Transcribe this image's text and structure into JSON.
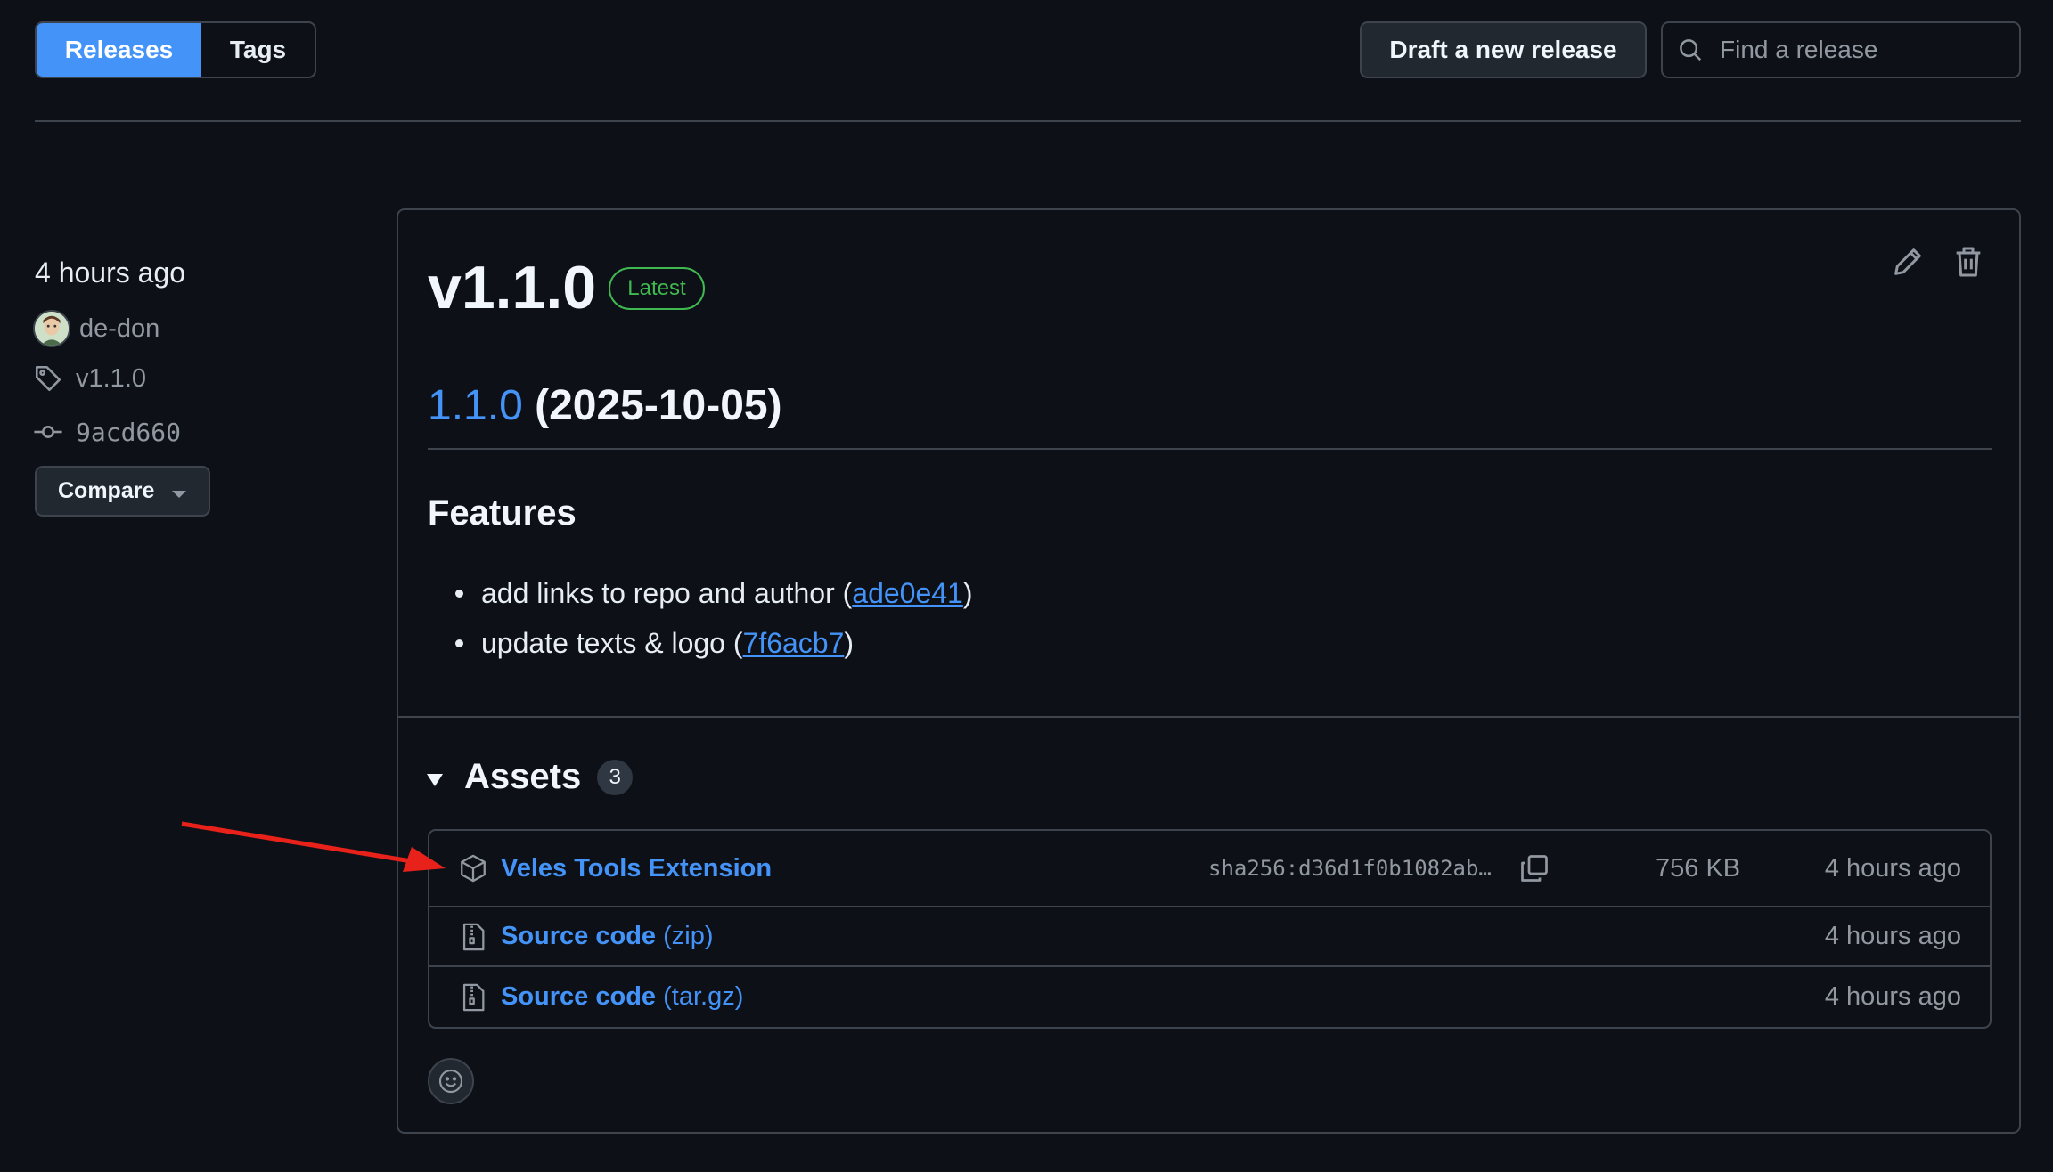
{
  "tabs": {
    "releases": "Releases",
    "tags": "Tags"
  },
  "toolbar": {
    "draft_label": "Draft a new release",
    "search_placeholder": "Find a release"
  },
  "sidebar": {
    "time": "4 hours ago",
    "author": "de-don",
    "tag": "v1.1.0",
    "commit": "9acd660",
    "compare_label": "Compare"
  },
  "release": {
    "title": "v1.1.0",
    "badge": "Latest",
    "version_link": "1.1.0",
    "version_date": "(2025-10-05)",
    "features_heading": "Features",
    "features": [
      {
        "text": "add links to repo and author (",
        "link": "ade0e41",
        "close": ")"
      },
      {
        "text": "update texts & logo (",
        "link": "7f6acb7",
        "close": ")"
      }
    ]
  },
  "assets": {
    "heading": "Assets",
    "count": "3",
    "items": [
      {
        "name": "Veles Tools Extension",
        "sha": "sha256:d36d1f0b1082ab…",
        "size": "756 KB",
        "time": "4 hours ago"
      },
      {
        "name": "Source code",
        "suffix": "(zip)",
        "time": "4 hours ago"
      },
      {
        "name": "Source code",
        "suffix": "(tar.gz)",
        "time": "4 hours ago"
      }
    ]
  },
  "colors": {
    "accent": "#4493f8",
    "latest": "#3fb950",
    "annotation_arrow": "#e8221b"
  },
  "icons": [
    "search-icon",
    "tag-icon",
    "commit-icon",
    "pencil-icon",
    "trash-icon",
    "package-icon",
    "file-zip-icon",
    "copy-icon",
    "smiley-icon"
  ]
}
